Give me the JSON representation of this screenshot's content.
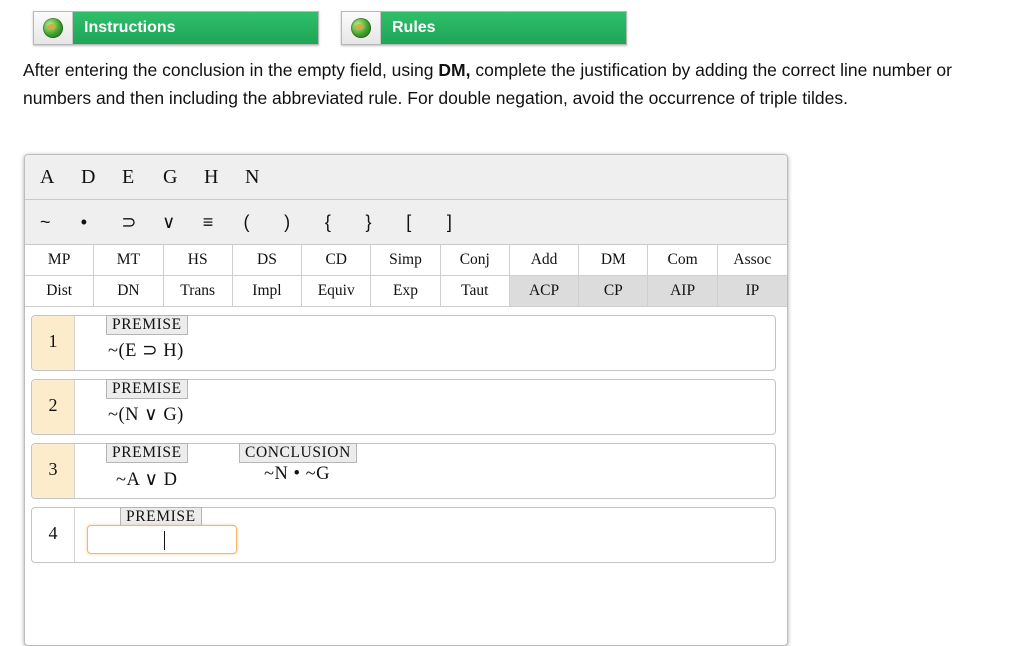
{
  "header": {
    "tabs": [
      {
        "label": "Instructions",
        "icon": "globe-icon"
      },
      {
        "label": "Rules",
        "icon": "globe-icon"
      }
    ]
  },
  "instructions": {
    "part1": "After entering the conclusion in the empty field, using ",
    "bold": "DM,",
    "part2": " complete the justification by adding the correct line number or numbers and then including the abbreviated rule. For double negation, avoid the occurrence of triple tildes."
  },
  "letters": [
    "A",
    "D",
    "E",
    "G",
    "H",
    "N"
  ],
  "symbols": [
    "~",
    "•",
    "⊃",
    "∨",
    "≡",
    "(",
    ")",
    "{",
    "}",
    "[",
    "]"
  ],
  "rules_row1": [
    "MP",
    "MT",
    "HS",
    "DS",
    "CD",
    "Simp",
    "Conj",
    "Add",
    "DM",
    "Com",
    "Assoc"
  ],
  "rules_row2": [
    "Dist",
    "DN",
    "Trans",
    "Impl",
    "Equiv",
    "Exp",
    "Taut",
    "ACP",
    "CP",
    "AIP",
    "IP"
  ],
  "lines": [
    {
      "number": "1",
      "label": "PREMISE",
      "formula": "~(E ⊃ H)"
    },
    {
      "number": "2",
      "label": "PREMISE",
      "formula": "~(N ∨ G)"
    },
    {
      "number": "3",
      "label": "PREMISE",
      "formula": "~A ∨ D",
      "conclusion_label": "CONCLUSION",
      "conclusion": "~N • ~G"
    },
    {
      "number": "4",
      "label": "PREMISE",
      "input_value": ""
    }
  ],
  "colors": {
    "tab_green": "#22a95a",
    "highlight": "#fdeccc",
    "input_focus": "#f2b66c"
  }
}
